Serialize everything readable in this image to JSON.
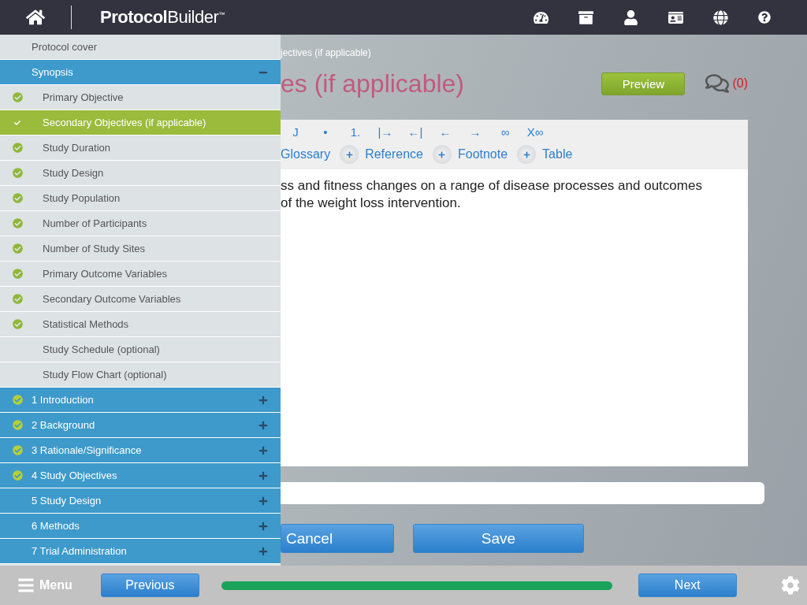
{
  "header": {
    "brand_bold": "Protocol",
    "brand_light": "Builder",
    "trademark": "™"
  },
  "sidebar": {
    "items": [
      {
        "label": "Protocol cover",
        "kind": "page",
        "done": false,
        "selected": false
      },
      {
        "label": "Synopsis",
        "kind": "section",
        "done": false,
        "selected": false,
        "expanded": true,
        "children": [
          {
            "label": "Primary Objective",
            "done": true,
            "selected": false
          },
          {
            "label": "Secondary Objectives (if applicable)",
            "done": true,
            "selected": true
          },
          {
            "label": "Study Duration",
            "done": true,
            "selected": false
          },
          {
            "label": "Study Design",
            "done": true,
            "selected": false
          },
          {
            "label": "Study Population",
            "done": true,
            "selected": false
          },
          {
            "label": "Number of Participants",
            "done": true,
            "selected": false
          },
          {
            "label": "Number of Study Sites",
            "done": true,
            "selected": false
          },
          {
            "label": "Primary Outcome Variables",
            "done": true,
            "selected": false
          },
          {
            "label": "Secondary Outcome Variables",
            "done": true,
            "selected": false
          },
          {
            "label": "Statistical Methods",
            "done": true,
            "selected": false
          },
          {
            "label": "Study Schedule (optional)",
            "done": false,
            "selected": false
          },
          {
            "label": "Study Flow Chart (optional)",
            "done": false,
            "selected": false
          }
        ]
      },
      {
        "label": "1 Introduction",
        "kind": "section",
        "done": true,
        "selected": false,
        "expanded": false
      },
      {
        "label": "2 Background",
        "kind": "section",
        "done": true,
        "selected": false,
        "expanded": false
      },
      {
        "label": "3 Rationale/Significance",
        "kind": "section",
        "done": true,
        "selected": false,
        "expanded": false
      },
      {
        "label": "4 Study Objectives",
        "kind": "section",
        "done": true,
        "selected": false,
        "expanded": false
      },
      {
        "label": "5 Study Design",
        "kind": "section",
        "done": false,
        "selected": false,
        "expanded": false
      },
      {
        "label": "6 Methods",
        "kind": "section",
        "done": false,
        "selected": false,
        "expanded": false
      },
      {
        "label": "7 Trial Administration",
        "kind": "section",
        "done": false,
        "selected": false,
        "expanded": false
      }
    ]
  },
  "main": {
    "breadcrumb": "jectives (if applicable)",
    "title": "es (if applicable)",
    "preview": "Preview",
    "comment_count": "(0)",
    "format_tools": [
      "J",
      "•",
      "1.",
      "|→",
      "←|",
      "←",
      "→",
      "∞",
      "X∞"
    ],
    "insert_buttons": [
      "Glossary",
      "Reference",
      "Footnote",
      "Table"
    ],
    "text_lines": [
      "ss and fitness changes on a range of disease processes and outcomes",
      "of the weight loss intervention."
    ],
    "cancel": "Cancel",
    "save": "Save"
  },
  "footer": {
    "menu": "Menu",
    "previous": "Previous",
    "next": "Next",
    "progress": {
      "level": 1
    }
  }
}
